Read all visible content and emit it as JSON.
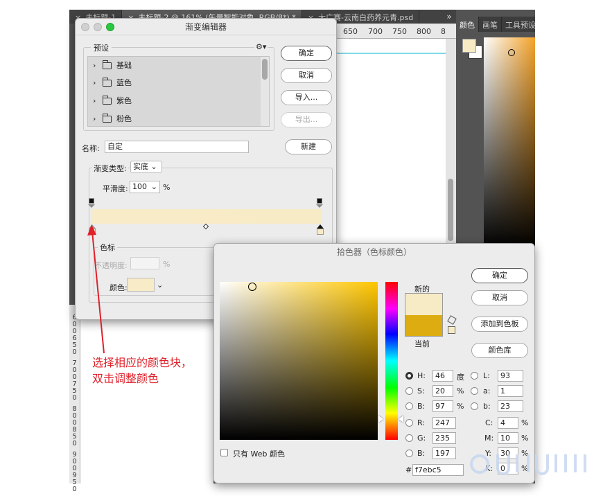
{
  "ps": {
    "tabs": [
      "未标题-1",
      "未标题-2 @ 161% (矢量智能对象, RGB/8*) *",
      "大广赛-云南白药养元青.psd"
    ],
    "tab_close": "×",
    "tab_overflow": "»",
    "ruler_top_labels": [
      "650",
      "700",
      "750",
      "800",
      "8"
    ],
    "ruler_left_labels": [
      "6",
      "0",
      "0",
      "6",
      "5",
      "0",
      "7",
      "0",
      "0",
      "7",
      "5",
      "0",
      "8",
      "0",
      "0",
      "8",
      "5",
      "0",
      "9",
      "0",
      "0",
      "9",
      "5",
      "0"
    ],
    "panel_tabs": [
      "颜色",
      "画笔",
      "工具预设"
    ]
  },
  "gradient_editor": {
    "title": "渐变编辑器",
    "presets_label": "预设",
    "presets": [
      "基础",
      "蓝色",
      "紫色",
      "粉色"
    ],
    "ok": "确定",
    "cancel": "取消",
    "import": "导入...",
    "export": "导出...",
    "name_label": "名称:",
    "name_value": "自定",
    "new_button": "新建",
    "type_label": "渐变类型:",
    "type_value": "实底",
    "smoothness_label": "平滑度:",
    "smoothness_value": "100",
    "percent": "%",
    "stops_label": "色标",
    "opacity_label": "不透明度:",
    "color_label": "颜色:",
    "gradient_start_color": "#f8ebc8",
    "gradient_end_color": "#f7ebc5"
  },
  "color_picker": {
    "title": "拾色器（色标颜色）",
    "new_label": "新的",
    "current_label": "当前",
    "new_color": "#f7ebc5",
    "current_color": "#dcac10",
    "ok": "确定",
    "cancel": "取消",
    "add_swatch": "添加到色板",
    "color_libraries": "颜色库",
    "web_only": "只有 Web 颜色",
    "fields": {
      "H": "46",
      "H_unit": "度",
      "S": "20",
      "S_unit": "%",
      "B": "97",
      "B_unit": "%",
      "R": "247",
      "G": "235",
      "B2": "197",
      "L": "93",
      "a": "1",
      "b": "23",
      "C": "4",
      "M": "10",
      "Y": "30",
      "K": "0",
      "pct": "%"
    },
    "hex_label": "#",
    "hex": "f7ebc5"
  },
  "annotation": {
    "line1": "选择相应的颜色块，",
    "line2": "双击调整颜色"
  }
}
